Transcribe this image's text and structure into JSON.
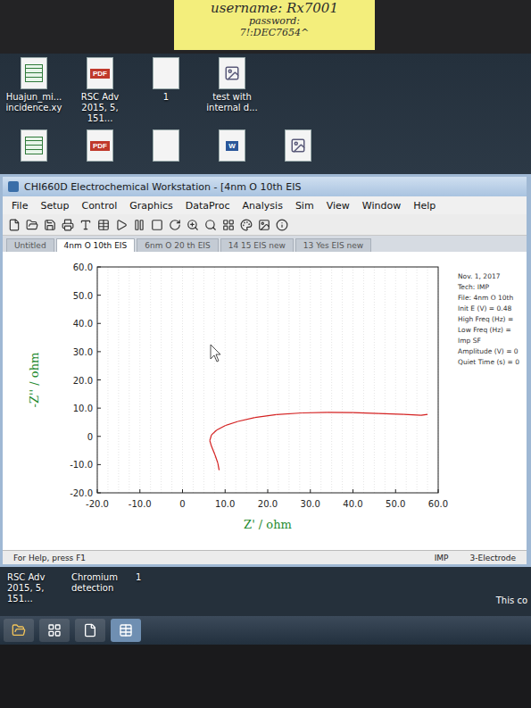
{
  "sticky_note": {
    "lines": [
      "username: Rx7001",
      "password:",
      "7!:DEC7654^"
    ]
  },
  "desktop_icons": [
    {
      "label": "Huajun_mi... incidence.xy",
      "kind": "excel",
      "badge": ""
    },
    {
      "label": "RSC Adv 2015, 5, 151...",
      "kind": "pdf",
      "badge": "PDF"
    },
    {
      "label": "1",
      "kind": "file",
      "badge": ""
    },
    {
      "label": "test with internal d...",
      "kind": "image",
      "badge": ""
    }
  ],
  "desktop_icons_row2": [
    {
      "kind": "excel",
      "badge": ""
    },
    {
      "kind": "pdf",
      "badge": "PDF"
    },
    {
      "kind": "file",
      "badge": ""
    },
    {
      "kind": "word",
      "badge": "W"
    },
    {
      "kind": "image",
      "badge": ""
    }
  ],
  "window": {
    "title": "CHI660D Electrochemical Workstation - [4nm O 10th EIS"
  },
  "menu": [
    "File",
    "Setup",
    "Control",
    "Graphics",
    "DataProc",
    "Analysis",
    "Sim",
    "View",
    "Window",
    "Help"
  ],
  "tabs": [
    {
      "label": "Untitled",
      "selected": false
    },
    {
      "label": "4nm O 10th EIS",
      "selected": true
    },
    {
      "label": "6nm O 20 th EIS",
      "selected": false
    },
    {
      "label": "14 15 EIS new",
      "selected": false
    },
    {
      "label": "13 Yes EIS new",
      "selected": false
    }
  ],
  "chart": {
    "x_label": "Z' / ohm",
    "y_label": "-Z'' / ohm",
    "x_ticks": [
      "-20.0",
      "-10.0",
      "0",
      "10.0",
      "20.0",
      "30.0",
      "40.0",
      "50.0",
      "60.0"
    ],
    "y_ticks": [
      "60.0",
      "50.0",
      "40.0",
      "30.0",
      "20.0",
      "10.0",
      "0",
      "-10.0",
      "-20.0"
    ],
    "series": [
      {
        "name": "EIS",
        "color": "#d42020",
        "z_real": [
          8.6,
          8.3,
          7.6,
          6.8,
          6.4,
          6.8,
          8.0,
          10.0,
          13.0,
          17.0,
          22.0,
          28.0,
          34.0,
          40.0,
          46.0,
          52.0,
          56.0,
          57.5
        ],
        "z_imag": [
          -12.0,
          -9.5,
          -6.5,
          -3.5,
          -1.5,
          0.5,
          2.2,
          3.8,
          5.3,
          6.7,
          7.7,
          8.3,
          8.5,
          8.4,
          8.1,
          7.8,
          7.5,
          7.8
        ]
      }
    ],
    "info": [
      "Nov. 1, 2017",
      "Tech: IMP",
      "File: 4nm O 10th",
      "Init E (V) = 0.48",
      "High Freq (Hz) =",
      "Low Freq (Hz) =",
      "Imp SF",
      "Amplitude (V) = 0",
      "Quiet Time (s) = 0"
    ]
  },
  "status_bar": {
    "help": "For Help, press F1",
    "mode": "IMP",
    "electrode": "3-Electrode"
  },
  "lower_desktop": {
    "labels": [
      "RSC Adv 2015, 5, 151...",
      "Chromium detection",
      "1"
    ],
    "right_text": "This co"
  }
}
